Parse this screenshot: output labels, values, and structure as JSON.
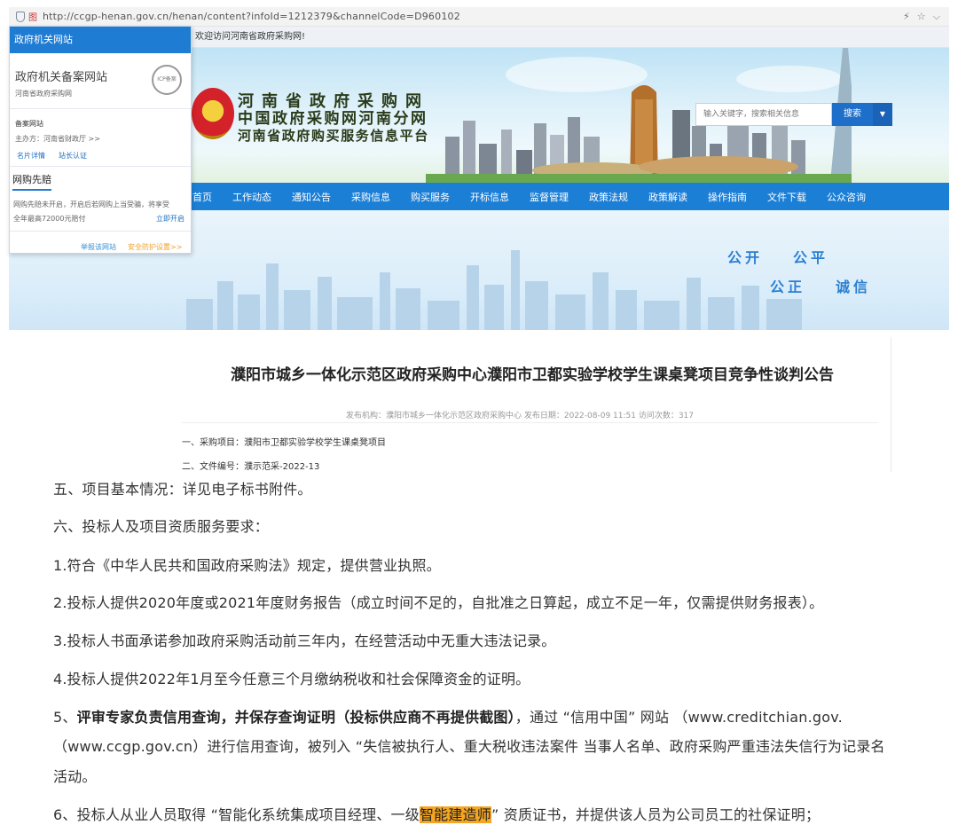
{
  "browser": {
    "url": "http://ccgp-henan.gov.cn/henan/content?infoId=1212379&channelCode=D960102",
    "noimg_label": "图"
  },
  "welcome": {
    "text": "欢迎访问河南省政府采购网!"
  },
  "header": {
    "line1": "河南省政府采购网",
    "line2": "中国政府采购网河南分网",
    "line3": "河南省政府购买服务信息平台",
    "search_placeholder": "输入关键字，搜索相关信息",
    "search_button": "搜索"
  },
  "nav": {
    "items": [
      "首页",
      "工作动态",
      "通知公告",
      "采购信息",
      "购买服务",
      "开标信息",
      "监督管理",
      "政策法规",
      "政策解读",
      "操作指南",
      "文件下载",
      "公众咨询"
    ]
  },
  "hero": {
    "slogan1": "公开",
    "slogan2": "公平",
    "slogan3": "公正",
    "slogan4": "诚信"
  },
  "panel": {
    "header": "政府机关网站",
    "title": "政府机关备案网站",
    "subtitle": "河南省政府采购网",
    "seal_text": "ICP备案",
    "record_label": "备案网站",
    "sponsor": "主办方：河南省财政厅 >>",
    "link_cert": "名片详情",
    "link_verify": "站长认证",
    "tab": "网购先赔",
    "desc1": "网购先赔未开启，开启后若网购上当受骗，将享受",
    "desc2": "全年最高72000元赔付",
    "open_link": "立即开启",
    "report": "举报该网站",
    "safety": "安全防护设置>>"
  },
  "article": {
    "title": "濮阳市城乡一体化示范区政府采购中心濮阳市卫都实验学校学生课桌凳项目竞争性谈判公告",
    "meta": "发布机构：濮阳市城乡一体化示范区政府采购中心    发布日期：2022-08-09 11:51    访问次数：317",
    "item1": "一、采购项目：濮阳市卫都实验学校学生课桌凳项目",
    "item2": "二、文件编号：濮示范采-2022-13"
  },
  "body": {
    "p5": "五、项目基本情况：详见电子标书附件。",
    "p6": "六、投标人及项目资质服务要求：",
    "r1": "1.符合《中华人民共和国政府采购法》规定，提供营业执照。",
    "r2": "2.投标人提供2020年度或2021年度财务报告（成立时间不足的，自批准之日算起，成立不足一年，仅需提供财务报表）。",
    "r3": "3.投标人书面承诺参加政府采购活动前三年内，在经营活动中无重大违法记录。",
    "r4": "4.投标人提供2022年1月至今任意三个月缴纳税收和社会保障资金的证明。",
    "r5_prefix": "5、",
    "r5_bold": "评审专家负责信用查询，并保存查询证明（投标供应商不再提供截图）",
    "r5_rest": "，通过 “信用中国” 网站 （www.creditchian.gov.",
    "r5_line2": "（www.ccgp.gov.cn）进行信用查询，被列入 “失信被执行人、重大税收违法案件 当事人名单、政府采购严重违法失信行为记录名",
    "r5_line3": "活动。",
    "r6_pre": "6、投标人从业人员取得 “智能化系统集成项目经理、一级",
    "r6_hl": "智能建造师",
    "r6_post": "” 资质证书，并提供该人员为公司员工的社保证明；"
  }
}
